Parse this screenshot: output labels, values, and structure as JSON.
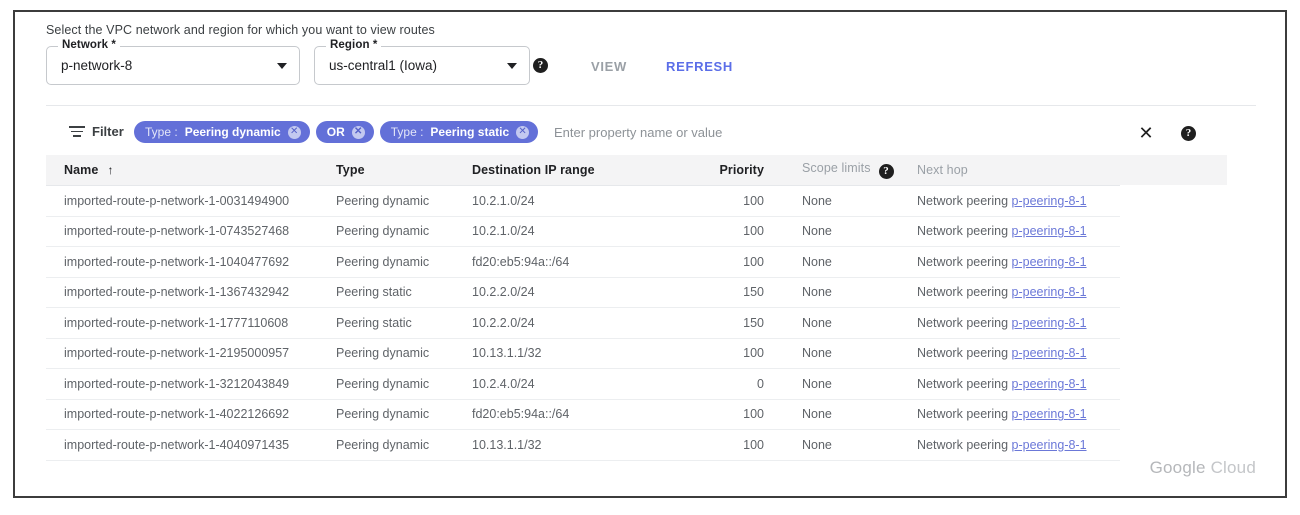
{
  "intro": {
    "text": "Select the VPC network and region for which you want to view routes"
  },
  "selector": {
    "network_field": {
      "label": "Network *",
      "value": "p-network-8"
    },
    "region_field": {
      "label": "Region *",
      "value": "us-central1 (Iowa)"
    },
    "region_help_glyph": "?",
    "view_button": "VIEW",
    "refresh_button": "REFRESH",
    "refresh_color": "#5b6ee8",
    "view_disabled_color": "#9aa0a6"
  },
  "filter_bar": {
    "label": "Filter",
    "chips": [
      {
        "key": "Type :",
        "value": "Peering dynamic",
        "close_glyph": "✕"
      },
      {
        "key": "",
        "value": "OR",
        "close_glyph": "✕"
      },
      {
        "key": "Type :",
        "value": "Peering static",
        "close_glyph": "✕"
      }
    ],
    "input_placeholder": "Enter property name or value",
    "close_glyph": "✕",
    "help_glyph": "?",
    "chip_color": "#6370d8"
  },
  "table": {
    "columns": [
      {
        "label": "Name",
        "sorted": true,
        "sort_glyph": "↑",
        "muted": false
      },
      {
        "label": "Type",
        "muted": false
      },
      {
        "label": "Destination IP range",
        "muted": false
      },
      {
        "label": "Priority",
        "muted": false
      },
      {
        "label": "Scope limits",
        "muted": true,
        "help_glyph": "?"
      },
      {
        "label": "Next hop",
        "muted": true
      }
    ],
    "rows": [
      {
        "name": "imported-route-p-network-1-0031494900",
        "type": "Peering dynamic",
        "destination": "10.2.1.0/24",
        "priority": "100",
        "scope_limits": "None",
        "next_hop_prefix": "Network peering",
        "next_hop_link": "p-peering-8-1"
      },
      {
        "name": "imported-route-p-network-1-0743527468",
        "type": "Peering dynamic",
        "destination": "10.2.1.0/24",
        "priority": "100",
        "scope_limits": "None",
        "next_hop_prefix": "Network peering",
        "next_hop_link": "p-peering-8-1"
      },
      {
        "name": "imported-route-p-network-1-1040477692",
        "type": "Peering dynamic",
        "destination": "fd20:eb5:94a::/64",
        "priority": "100",
        "scope_limits": "None",
        "next_hop_prefix": "Network peering",
        "next_hop_link": "p-peering-8-1"
      },
      {
        "name": "imported-route-p-network-1-1367432942",
        "type": "Peering static",
        "destination": "10.2.2.0/24",
        "priority": "150",
        "scope_limits": "None",
        "next_hop_prefix": "Network peering",
        "next_hop_link": "p-peering-8-1"
      },
      {
        "name": "imported-route-p-network-1-1777110608",
        "type": "Peering static",
        "destination": "10.2.2.0/24",
        "priority": "150",
        "scope_limits": "None",
        "next_hop_prefix": "Network peering",
        "next_hop_link": "p-peering-8-1"
      },
      {
        "name": "imported-route-p-network-1-2195000957",
        "type": "Peering dynamic",
        "destination": "10.13.1.1/32",
        "priority": "100",
        "scope_limits": "None",
        "next_hop_prefix": "Network peering",
        "next_hop_link": "p-peering-8-1"
      },
      {
        "name": "imported-route-p-network-1-3212043849",
        "type": "Peering dynamic",
        "destination": "10.2.4.0/24",
        "priority": "0",
        "scope_limits": "None",
        "next_hop_prefix": "Network peering",
        "next_hop_link": "p-peering-8-1"
      },
      {
        "name": "imported-route-p-network-1-4022126692",
        "type": "Peering dynamic",
        "destination": "fd20:eb5:94a::/64",
        "priority": "100",
        "scope_limits": "None",
        "next_hop_prefix": "Network peering",
        "next_hop_link": "p-peering-8-1"
      },
      {
        "name": "imported-route-p-network-1-4040971435",
        "type": "Peering dynamic",
        "destination": "10.13.1.1/32",
        "priority": "100",
        "scope_limits": "None",
        "next_hop_prefix": "Network peering",
        "next_hop_link": "p-peering-8-1"
      }
    ]
  },
  "footer": {
    "brand_primary": "Google",
    "brand_secondary": "Cloud"
  }
}
